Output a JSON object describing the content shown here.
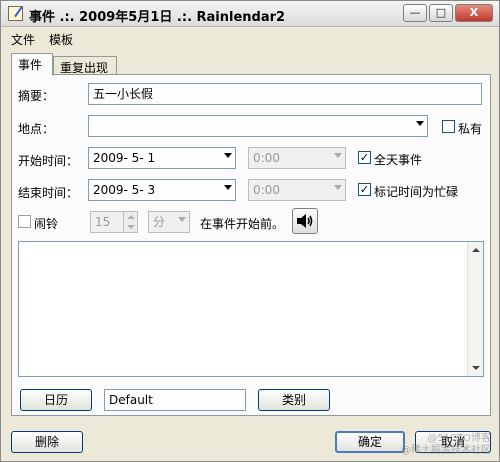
{
  "window": {
    "title": "事件 .:. 2009年5月1日 .:. Rainlendar2",
    "minimize": "—",
    "maximize": "□",
    "close": "X"
  },
  "menu": {
    "file": "文件",
    "template": "模板"
  },
  "tabs": {
    "event": "事件",
    "recurrence": "重复出现"
  },
  "form": {
    "summary_label": "摘要：",
    "summary_value": "五一小长假",
    "location_label": "地点：",
    "location_value": "",
    "private_label": "私有",
    "start_label": "开始时间：",
    "start_date": "2009- 5- 1",
    "start_time": "0:00",
    "allday_label": "全天事件",
    "end_label": "结束时间：",
    "end_date": "2009- 5- 3",
    "end_time": "0:00",
    "busy_label": "标记时间为忙碌",
    "alarm_label": "闹铃",
    "alarm_value": "15",
    "alarm_unit": "分",
    "alarm_suffix": "在事件开始前。",
    "description": ""
  },
  "bottom": {
    "calendar_button": "日历",
    "calendar_value": "Default",
    "category_button": "类别",
    "delete_button": "删除",
    "ok_button": "确定",
    "cancel_button": "取消"
  },
  "watermark": {
    "line1": "@51CTO博客",
    "line2": "@稀土掘金技术社区"
  },
  "icons": {
    "app": "pencil-note-icon",
    "speaker": "speaker-icon",
    "dropdown": "chevron-down-icon"
  },
  "colors": {
    "frame": "#ece9d8",
    "input_border": "#7f9db9",
    "default_button": "#4a79c0"
  }
}
